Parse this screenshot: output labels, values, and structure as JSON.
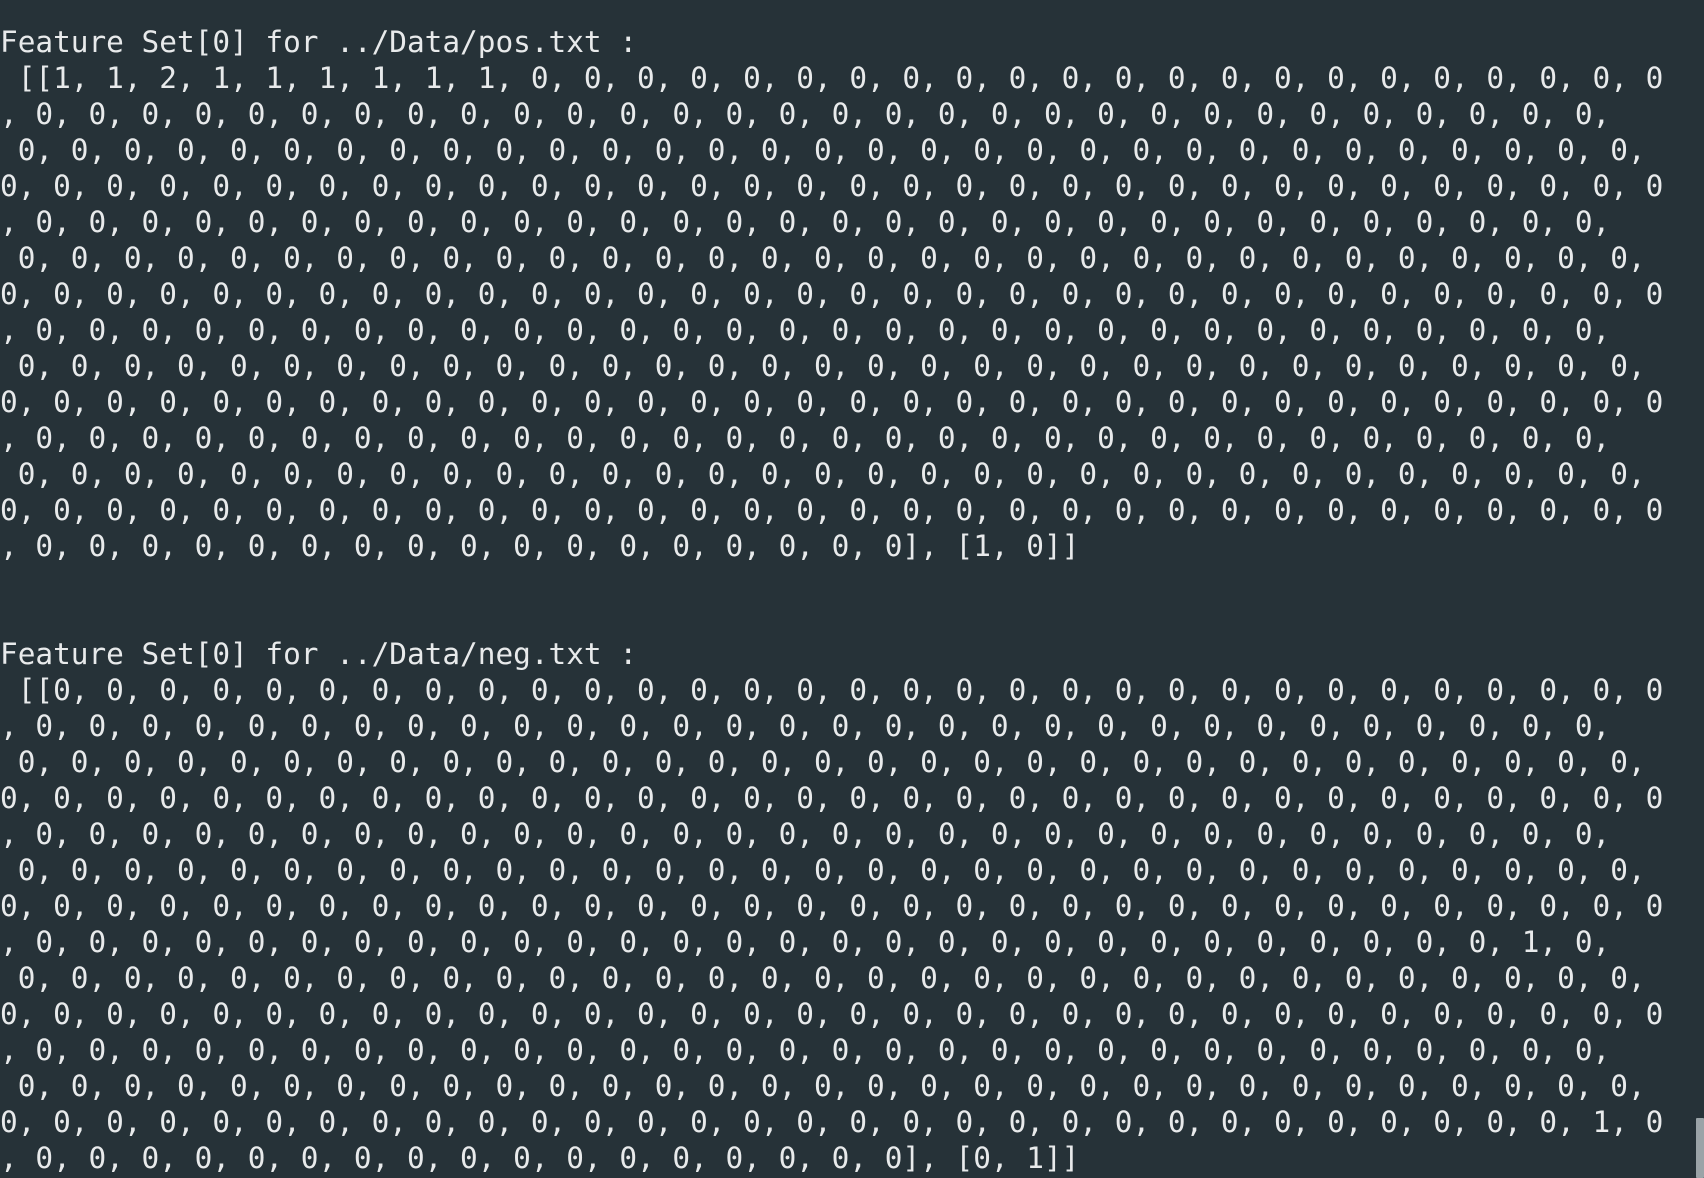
{
  "terminal": {
    "lines": [
      "Feature Set[0] for ../Data/pos.txt :",
      " [[1, 1, 2, 1, 1, 1, 1, 1, 1, 0, 0, 0, 0, 0, 0, 0, 0, 0, 0, 0, 0, 0, 0, 0, 0, 0, 0, 0, 0, 0, 0",
      ", 0, 0, 0, 0, 0, 0, 0, 0, 0, 0, 0, 0, 0, 0, 0, 0, 0, 0, 0, 0, 0, 0, 0, 0, 0, 0, 0, 0, 0, 0,",
      " 0, 0, 0, 0, 0, 0, 0, 0, 0, 0, 0, 0, 0, 0, 0, 0, 0, 0, 0, 0, 0, 0, 0, 0, 0, 0, 0, 0, 0, 0, 0,",
      "0, 0, 0, 0, 0, 0, 0, 0, 0, 0, 0, 0, 0, 0, 0, 0, 0, 0, 0, 0, 0, 0, 0, 0, 0, 0, 0, 0, 0, 0, 0, 0",
      ", 0, 0, 0, 0, 0, 0, 0, 0, 0, 0, 0, 0, 0, 0, 0, 0, 0, 0, 0, 0, 0, 0, 0, 0, 0, 0, 0, 0, 0, 0,",
      " 0, 0, 0, 0, 0, 0, 0, 0, 0, 0, 0, 0, 0, 0, 0, 0, 0, 0, 0, 0, 0, 0, 0, 0, 0, 0, 0, 0, 0, 0, 0,",
      "0, 0, 0, 0, 0, 0, 0, 0, 0, 0, 0, 0, 0, 0, 0, 0, 0, 0, 0, 0, 0, 0, 0, 0, 0, 0, 0, 0, 0, 0, 0, 0",
      ", 0, 0, 0, 0, 0, 0, 0, 0, 0, 0, 0, 0, 0, 0, 0, 0, 0, 0, 0, 0, 0, 0, 0, 0, 0, 0, 0, 0, 0, 0,",
      " 0, 0, 0, 0, 0, 0, 0, 0, 0, 0, 0, 0, 0, 0, 0, 0, 0, 0, 0, 0, 0, 0, 0, 0, 0, 0, 0, 0, 0, 0, 0,",
      "0, 0, 0, 0, 0, 0, 0, 0, 0, 0, 0, 0, 0, 0, 0, 0, 0, 0, 0, 0, 0, 0, 0, 0, 0, 0, 0, 0, 0, 0, 0, 0",
      ", 0, 0, 0, 0, 0, 0, 0, 0, 0, 0, 0, 0, 0, 0, 0, 0, 0, 0, 0, 0, 0, 0, 0, 0, 0, 0, 0, 0, 0, 0,",
      " 0, 0, 0, 0, 0, 0, 0, 0, 0, 0, 0, 0, 0, 0, 0, 0, 0, 0, 0, 0, 0, 0, 0, 0, 0, 0, 0, 0, 0, 0, 0,",
      "0, 0, 0, 0, 0, 0, 0, 0, 0, 0, 0, 0, 0, 0, 0, 0, 0, 0, 0, 0, 0, 0, 0, 0, 0, 0, 0, 0, 0, 0, 0, 0",
      ", 0, 0, 0, 0, 0, 0, 0, 0, 0, 0, 0, 0, 0, 0, 0, 0, 0], [1, 0]]",
      "",
      "",
      "Feature Set[0] for ../Data/neg.txt :",
      " [[0, 0, 0, 0, 0, 0, 0, 0, 0, 0, 0, 0, 0, 0, 0, 0, 0, 0, 0, 0, 0, 0, 0, 0, 0, 0, 0, 0, 0, 0, 0",
      ", 0, 0, 0, 0, 0, 0, 0, 0, 0, 0, 0, 0, 0, 0, 0, 0, 0, 0, 0, 0, 0, 0, 0, 0, 0, 0, 0, 0, 0, 0,",
      " 0, 0, 0, 0, 0, 0, 0, 0, 0, 0, 0, 0, 0, 0, 0, 0, 0, 0, 0, 0, 0, 0, 0, 0, 0, 0, 0, 0, 0, 0, 0,",
      "0, 0, 0, 0, 0, 0, 0, 0, 0, 0, 0, 0, 0, 0, 0, 0, 0, 0, 0, 0, 0, 0, 0, 0, 0, 0, 0, 0, 0, 0, 0, 0",
      ", 0, 0, 0, 0, 0, 0, 0, 0, 0, 0, 0, 0, 0, 0, 0, 0, 0, 0, 0, 0, 0, 0, 0, 0, 0, 0, 0, 0, 0, 0,",
      " 0, 0, 0, 0, 0, 0, 0, 0, 0, 0, 0, 0, 0, 0, 0, 0, 0, 0, 0, 0, 0, 0, 0, 0, 0, 0, 0, 0, 0, 0, 0,",
      "0, 0, 0, 0, 0, 0, 0, 0, 0, 0, 0, 0, 0, 0, 0, 0, 0, 0, 0, 0, 0, 0, 0, 0, 0, 0, 0, 0, 0, 0, 0, 0",
      ", 0, 0, 0, 0, 0, 0, 0, 0, 0, 0, 0, 0, 0, 0, 0, 0, 0, 0, 0, 0, 0, 0, 0, 0, 0, 0, 0, 0, 1, 0,",
      " 0, 0, 0, 0, 0, 0, 0, 0, 0, 0, 0, 0, 0, 0, 0, 0, 0, 0, 0, 0, 0, 0, 0, 0, 0, 0, 0, 0, 0, 0, 0,",
      "0, 0, 0, 0, 0, 0, 0, 0, 0, 0, 0, 0, 0, 0, 0, 0, 0, 0, 0, 0, 0, 0, 0, 0, 0, 0, 0, 0, 0, 0, 0, 0",
      ", 0, 0, 0, 0, 0, 0, 0, 0, 0, 0, 0, 0, 0, 0, 0, 0, 0, 0, 0, 0, 0, 0, 0, 0, 0, 0, 0, 0, 0, 0,",
      " 0, 0, 0, 0, 0, 0, 0, 0, 0, 0, 0, 0, 0, 0, 0, 0, 0, 0, 0, 0, 0, 0, 0, 0, 0, 0, 0, 0, 0, 0, 0,",
      "0, 0, 0, 0, 0, 0, 0, 0, 0, 0, 0, 0, 0, 0, 0, 0, 0, 0, 0, 0, 0, 0, 0, 0, 0, 0, 0, 0, 0, 0, 1, 0",
      ", 0, 0, 0, 0, 0, 0, 0, 0, 0, 0, 0, 0, 0, 0, 0, 0, 0], [0, 1]]"
    ]
  },
  "colors": {
    "background": "#263238",
    "foreground": "#e8eaeb",
    "scroll_thumb": "#9aa3a7"
  }
}
